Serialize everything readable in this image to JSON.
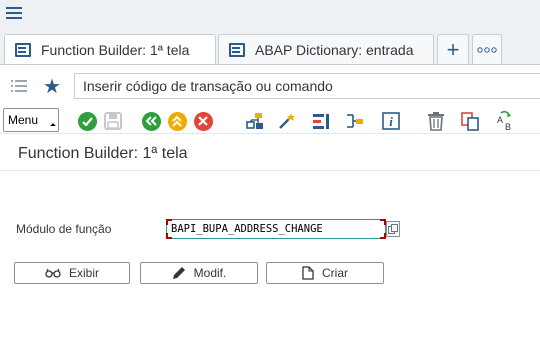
{
  "shell": {
    "menu_icon": "hamburger-icon"
  },
  "tabs": [
    {
      "label": "Function Builder: 1ª tela",
      "icon": "window-icon",
      "active": true
    },
    {
      "label": "ABAP Dictionary: entrada",
      "icon": "window-icon",
      "active": false
    }
  ],
  "tab_actions": {
    "new_tab_label": "+",
    "more_label": "○○○"
  },
  "command": {
    "placeholder": "Inserir código de transação ou comando",
    "value": ""
  },
  "toolbar": {
    "menu_label": "Menu",
    "icons": [
      "check-icon",
      "save-icon",
      "back-icon",
      "exit-icon",
      "cancel-icon",
      "object-list-icon",
      "magic-wand-icon",
      "where-used-icon",
      "navigation-icon",
      "info-icon",
      "delete-icon",
      "copy-icon",
      "rename-icon"
    ],
    "colors": {
      "check": "#2e9e3f",
      "back": "#2e9e3f",
      "exit": "#f0ab00",
      "cancel": "#e0453a",
      "save_disabled": "#c4c8cc"
    }
  },
  "page": {
    "title": "Function Builder: 1ª tela"
  },
  "form": {
    "label": "Módulo de função",
    "value": "BAPI_BUPA_ADDRESS_CHANGE"
  },
  "actions": {
    "display_label": "Exibir",
    "change_label": "Modif.",
    "create_label": "Criar"
  }
}
